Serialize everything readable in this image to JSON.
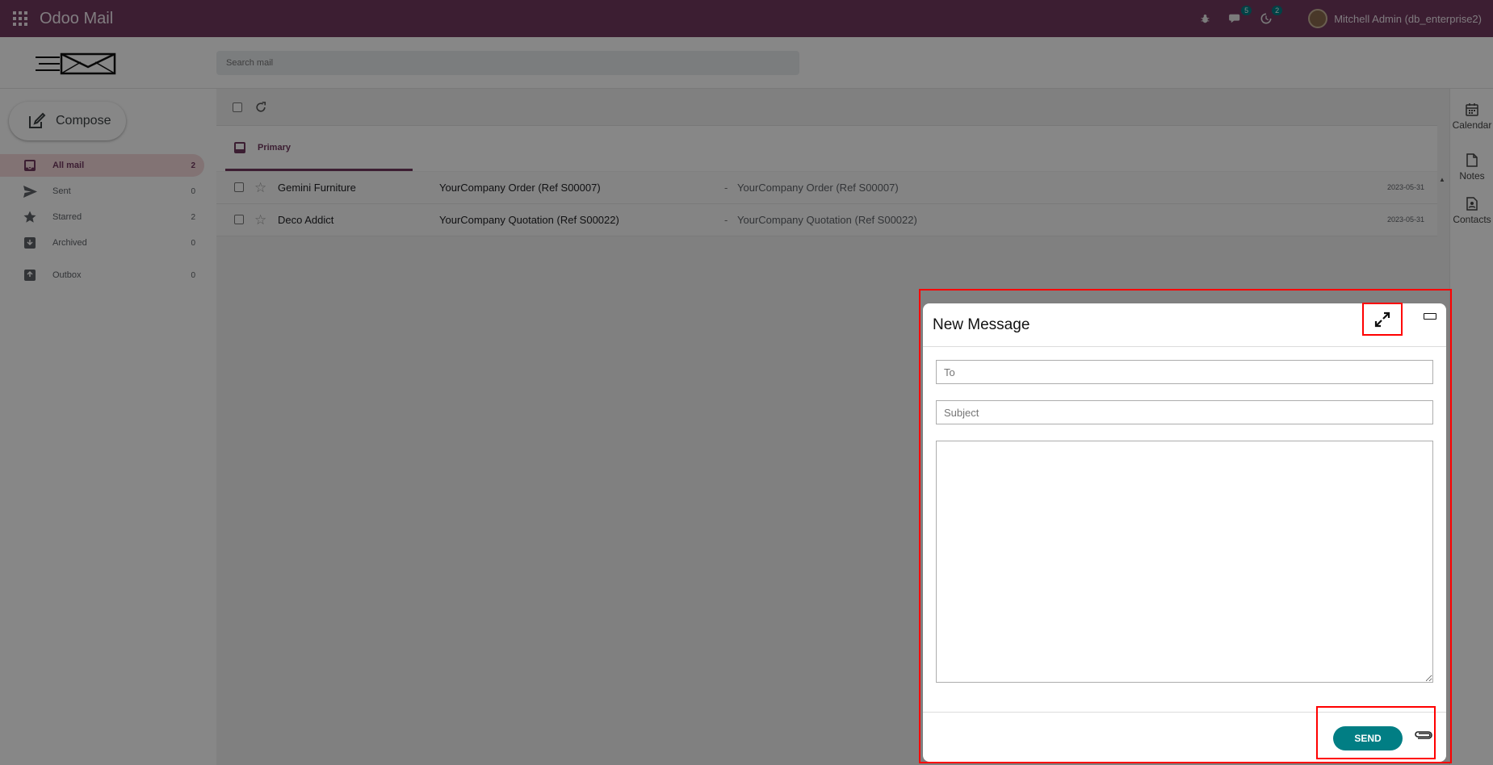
{
  "topbar": {
    "app_title": "Odoo Mail",
    "chat_badge": "5",
    "activity_badge": "2",
    "user_name": "Mitchell Admin (db_enterprise2)"
  },
  "header": {
    "search_placeholder": "Search mail"
  },
  "sidebar": {
    "compose_label": "Compose",
    "items": [
      {
        "label": "All mail",
        "count": "2",
        "icon": "inbox-icon",
        "active": true
      },
      {
        "label": "Sent",
        "count": "0",
        "icon": "send-icon"
      },
      {
        "label": "Starred",
        "count": "2",
        "icon": "star-icon"
      },
      {
        "label": "Archived",
        "count": "0",
        "icon": "archive-icon"
      },
      {
        "label": "Outbox",
        "count": "0",
        "icon": "outbox-icon"
      }
    ]
  },
  "main": {
    "tab_label": "Primary",
    "emails": [
      {
        "sender": "Gemini Furniture",
        "subject": "YourCompany Order (Ref S00007)",
        "preview": "YourCompany Order (Ref S00007)",
        "date": "2023-05-31"
      },
      {
        "sender": "Deco Addict",
        "subject": "YourCompany Quotation (Ref S00022)",
        "preview": "YourCompany Quotation (Ref S00022)",
        "date": "2023-05-31"
      }
    ]
  },
  "right_rail": {
    "items": [
      {
        "label": "Calendar",
        "icon": "calendar-icon"
      },
      {
        "label": "Notes",
        "icon": "note-icon"
      },
      {
        "label": "Contacts",
        "icon": "contacts-icon"
      }
    ]
  },
  "compose_dialog": {
    "title": "New Message",
    "to_placeholder": "To",
    "subject_placeholder": "Subject",
    "send_label": "SEND"
  },
  "colors": {
    "brand": "#71395f",
    "accent": "#017e84",
    "highlight": "#ff0000"
  }
}
